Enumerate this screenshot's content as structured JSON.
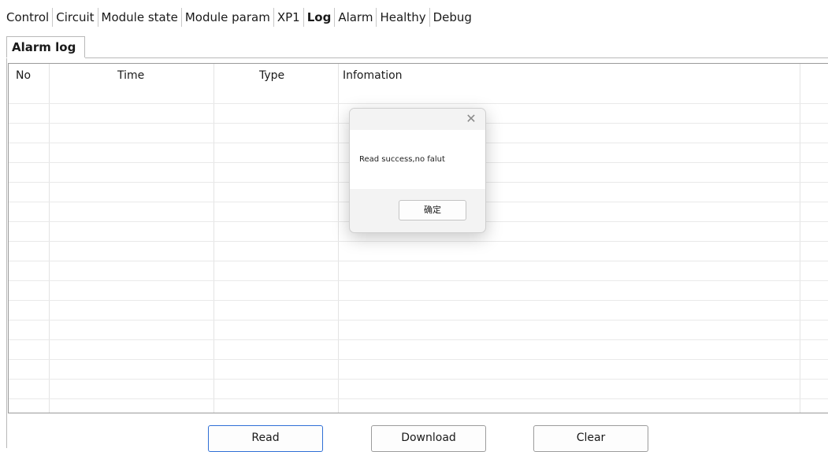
{
  "tabs": [
    "Control",
    "Circuit",
    "Module state",
    "Module param",
    "XP1",
    "Log",
    "Alarm",
    "Healthy",
    "Debug"
  ],
  "active_tab": "Log",
  "subtab": {
    "label": "Alarm log"
  },
  "table": {
    "columns": [
      "No",
      "Time",
      "Type",
      "Infomation"
    ],
    "rows": []
  },
  "buttons": {
    "read": "Read",
    "download": "Download",
    "clear": "Clear"
  },
  "dialog": {
    "message": "Read success,no falut",
    "ok_label": "确定",
    "close_icon": "close-icon"
  }
}
